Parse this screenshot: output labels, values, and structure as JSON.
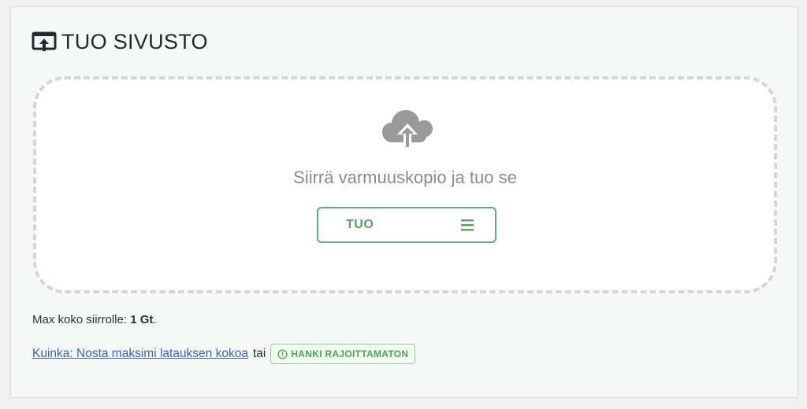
{
  "page": {
    "title": "TUO SIVUSTO",
    "title_icon": "site-import-icon"
  },
  "dropzone": {
    "icon": "cloud-upload-icon",
    "message": "Siirrä varmuuskopio ja tuo se",
    "import_button": {
      "label": "TUO",
      "menu_icon": "hamburger-menu-icon"
    }
  },
  "footer": {
    "max_size_label": "Max koko siirrolle:",
    "max_size_value": "1 Gt",
    "max_size_suffix": ".",
    "howto_link": "Kuinka: Nosta maksimi latauksen kokoa",
    "or_text": "tai",
    "unlimited_label": "HANKI RAJOITTAMATON",
    "unlimited_icon": "info-circle-icon"
  },
  "colors": {
    "accent_green": "#65ad6e",
    "link_blue": "#3e62b5",
    "muted_gray": "#8a8a8a"
  }
}
